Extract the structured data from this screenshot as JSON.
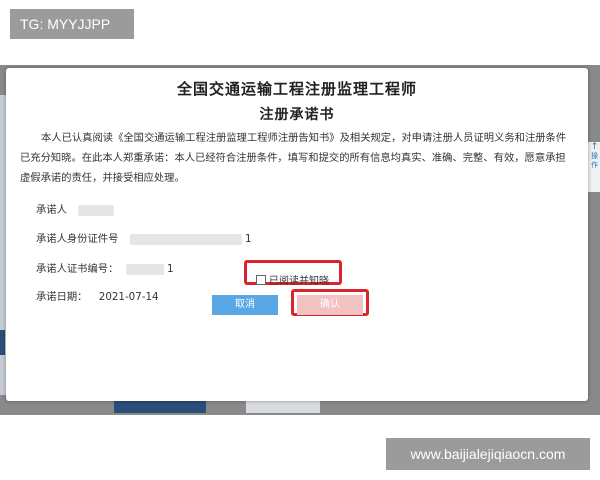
{
  "watermarks": {
    "top": "TG: MYYJJPP",
    "bottom": "www.baijialejiqiaocn.com"
  },
  "dialog": {
    "title_line1": "全国交通运输工程注册监理工程师",
    "title_line2": "注册承诺书",
    "statement": "本人已认真阅读《全国交通运输工程注册监理工程师注册告知书》及相关规定，对申请注册人员证明义务和注册条件已充分知晓。在此本人郑重承诺：本人已经符合注册条件，填写和提交的所有信息均真实、准确、完整、有效，愿意承担虚假承诺的责任，并接受相应处理。",
    "fields": {
      "promiser_label": "承诺人",
      "promiser_value": "",
      "id_label": "承诺人身份证件号",
      "id_suffix": "1",
      "cert_label": "承诺人证书编号：",
      "cert_suffix": "1",
      "date_label": "承诺日期：",
      "date_value": "2021-07-14"
    },
    "agree_checkbox_label": "已阅读并知晓",
    "agree_checked": false,
    "cancel_label": "取消",
    "confirm_label": "确认"
  },
  "colors": {
    "highlight": "#d9262c",
    "cancel_button": "#5aa7e5",
    "confirm_button_disabled": "#f2c2c2",
    "overlay": "#8a8a8a"
  },
  "background": {
    "right_tab_label": "操作"
  }
}
